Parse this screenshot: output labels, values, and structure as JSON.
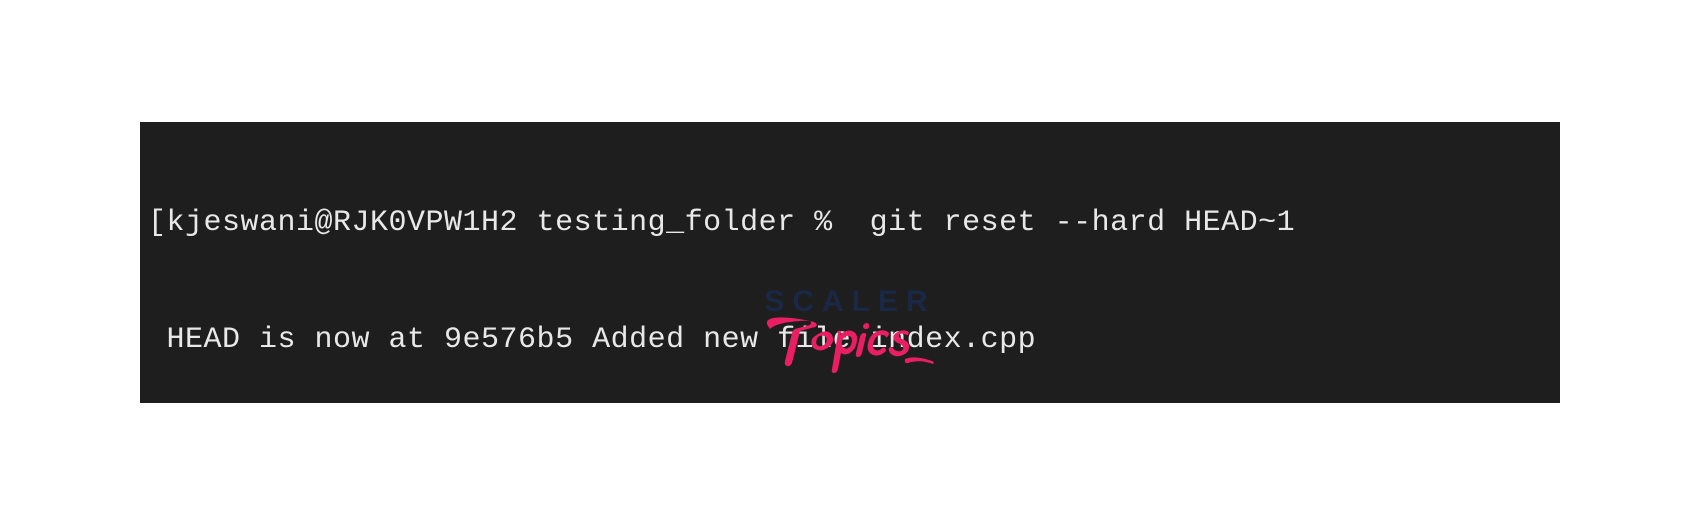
{
  "terminal": {
    "line1": "[kjeswani@RJK0VPW1H2 testing_folder %  git reset --hard HEAD~1",
    "line2": " HEAD is now at 9e576b5 Added new file index.cpp"
  },
  "logo": {
    "scaler_text": "SCALER",
    "topics_text": "Topics",
    "scaler_color": "#1a2847",
    "topics_color": "#e91e63"
  }
}
